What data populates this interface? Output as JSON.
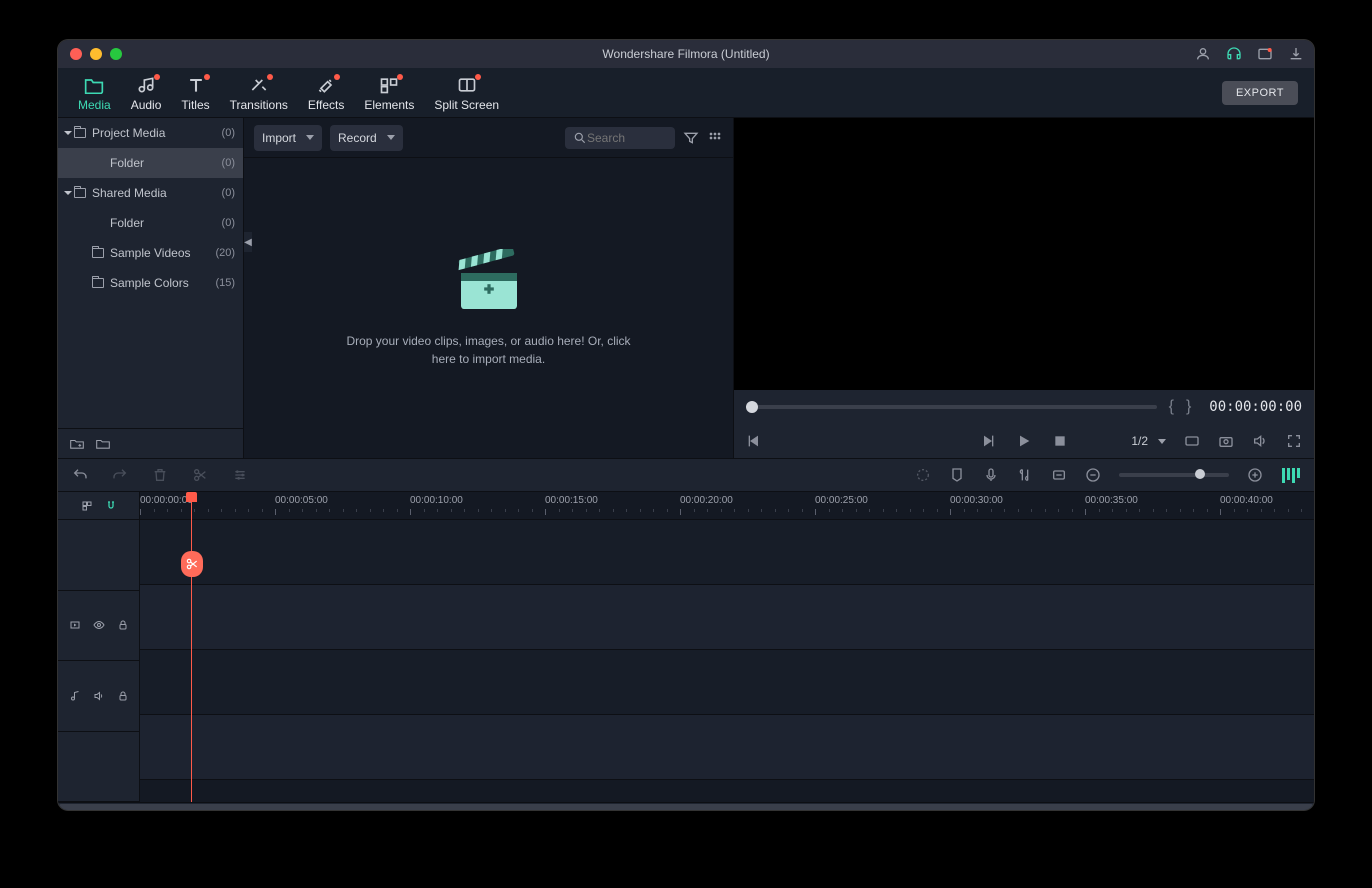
{
  "window": {
    "title": "Wondershare Filmora (Untitled)"
  },
  "tabs": [
    {
      "label": "Media",
      "icon": "folder-icon",
      "active": true,
      "dot": false
    },
    {
      "label": "Audio",
      "icon": "audio-icon",
      "active": false,
      "dot": true
    },
    {
      "label": "Titles",
      "icon": "titles-icon",
      "active": false,
      "dot": true
    },
    {
      "label": "Transitions",
      "icon": "transitions-icon",
      "active": false,
      "dot": true
    },
    {
      "label": "Effects",
      "icon": "effects-icon",
      "active": false,
      "dot": true
    },
    {
      "label": "Elements",
      "icon": "elements-icon",
      "active": false,
      "dot": true
    },
    {
      "label": "Split Screen",
      "icon": "splitscreen-icon",
      "active": false,
      "dot": true
    }
  ],
  "export_label": "EXPORT",
  "sidebar": {
    "nodes": [
      {
        "label": "Project Media",
        "count": "(0)",
        "indent": 0,
        "expandable": true,
        "folder": true,
        "sel": false
      },
      {
        "label": "Folder",
        "count": "(0)",
        "indent": 1,
        "expandable": false,
        "folder": false,
        "sel": true
      },
      {
        "label": "Shared Media",
        "count": "(0)",
        "indent": 0,
        "expandable": true,
        "folder": true,
        "sel": false
      },
      {
        "label": "Folder",
        "count": "(0)",
        "indent": 1,
        "expandable": false,
        "folder": false,
        "sel": false
      },
      {
        "label": "Sample Videos",
        "count": "(20)",
        "indent": 1,
        "expandable": false,
        "folder": true,
        "sel": false
      },
      {
        "label": "Sample Colors",
        "count": "(15)",
        "indent": 1,
        "expandable": false,
        "folder": true,
        "sel": false
      }
    ]
  },
  "media_toolbar": {
    "import_label": "Import",
    "record_label": "Record",
    "search_placeholder": "Search"
  },
  "dropzone_text": "Drop your video clips, images, or audio here! Or, click here to import media.",
  "preview": {
    "timecode": "00:00:00:00",
    "zoom_label": "1/2"
  },
  "ruler": {
    "ticks": [
      "00:00:00:00",
      "00:00:05:00",
      "00:00:10:00",
      "00:00:15:00",
      "00:00:20:00",
      "00:00:25:00",
      "00:00:30:00",
      "00:00:35:00",
      "00:00:40:00"
    ]
  }
}
